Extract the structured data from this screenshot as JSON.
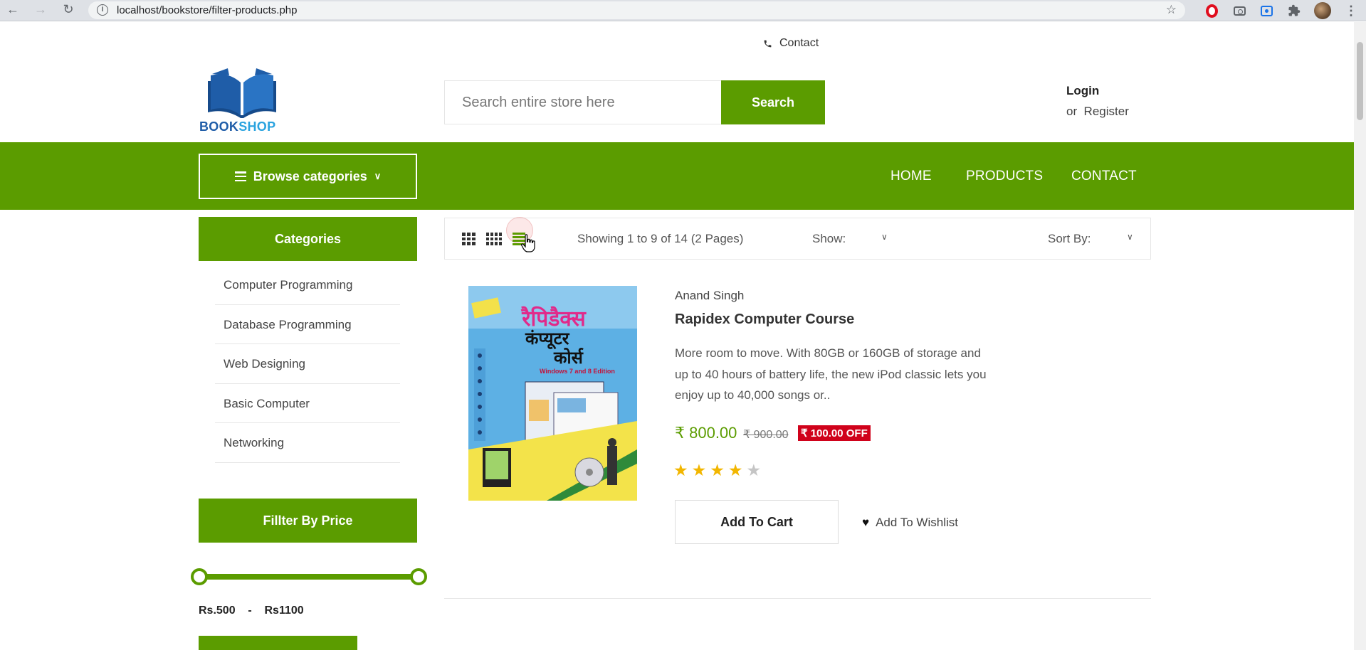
{
  "browser": {
    "url": "localhost/bookstore/filter-products.php"
  },
  "header": {
    "contact": "Contact",
    "logo": {
      "part1": "BOOK",
      "part2": "SHOP"
    },
    "search": {
      "placeholder": "Search entire store here",
      "button": "Search"
    },
    "login": "Login",
    "register": "or  Register"
  },
  "navbar": {
    "browse": "Browse categories",
    "links": [
      "HOME",
      "PRODUCTS",
      "CONTACT"
    ]
  },
  "sidebar": {
    "categories_title": "Categories",
    "categories": [
      "Computer Programming",
      "Database Programming",
      "Web Designing",
      "Basic Computer",
      "Networking"
    ],
    "filter_title": "Fillter By Price",
    "price_range": "Rs.500    -    Rs1100"
  },
  "toolbar": {
    "showing": "Showing 1 to 9 of 14 (2 Pages)",
    "show_label": "Show:",
    "sort_label": "Sort By:"
  },
  "product": {
    "author": "Anand Singh",
    "title": "Rapidex Computer Course",
    "description": "More room to move. With 80GB or 160GB of storage and up to 40 hours of battery life, the new iPod classic lets you enjoy up to 40,000 songs or..",
    "price": "₹ 800.00",
    "old_price": "₹ 900.00",
    "discount": "₹ 100.00 OFF",
    "rating": 4,
    "rating_max": 5,
    "add_to_cart": "Add To Cart",
    "add_to_wishlist": "Add To Wishlist",
    "cover": {
      "title_line1": "रैपिडैक्स",
      "title_line2": "कंप्यूटर",
      "title_line3": "कोर्स",
      "edition": "Windows 7 and 8 Edition"
    }
  },
  "colors": {
    "brand_green": "#5b9c00",
    "badge_red": "#d0021b",
    "star": "#f2b600"
  }
}
